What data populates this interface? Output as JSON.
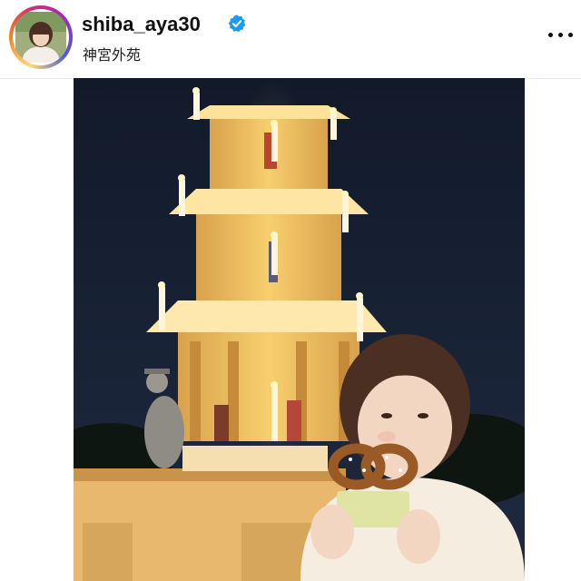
{
  "post": {
    "username": "shiba_aya30",
    "location": "神宮外苑",
    "verified": true
  },
  "icons": {
    "avatar": "profile-photo",
    "verified": "verified-badge-icon",
    "more": "more-options-icon"
  },
  "colors": {
    "verified_blue": "#1d9bf0",
    "story_ring": [
      "#feda75",
      "#fa7e1e",
      "#d62976",
      "#962fbf",
      "#4f5bd5"
    ]
  }
}
